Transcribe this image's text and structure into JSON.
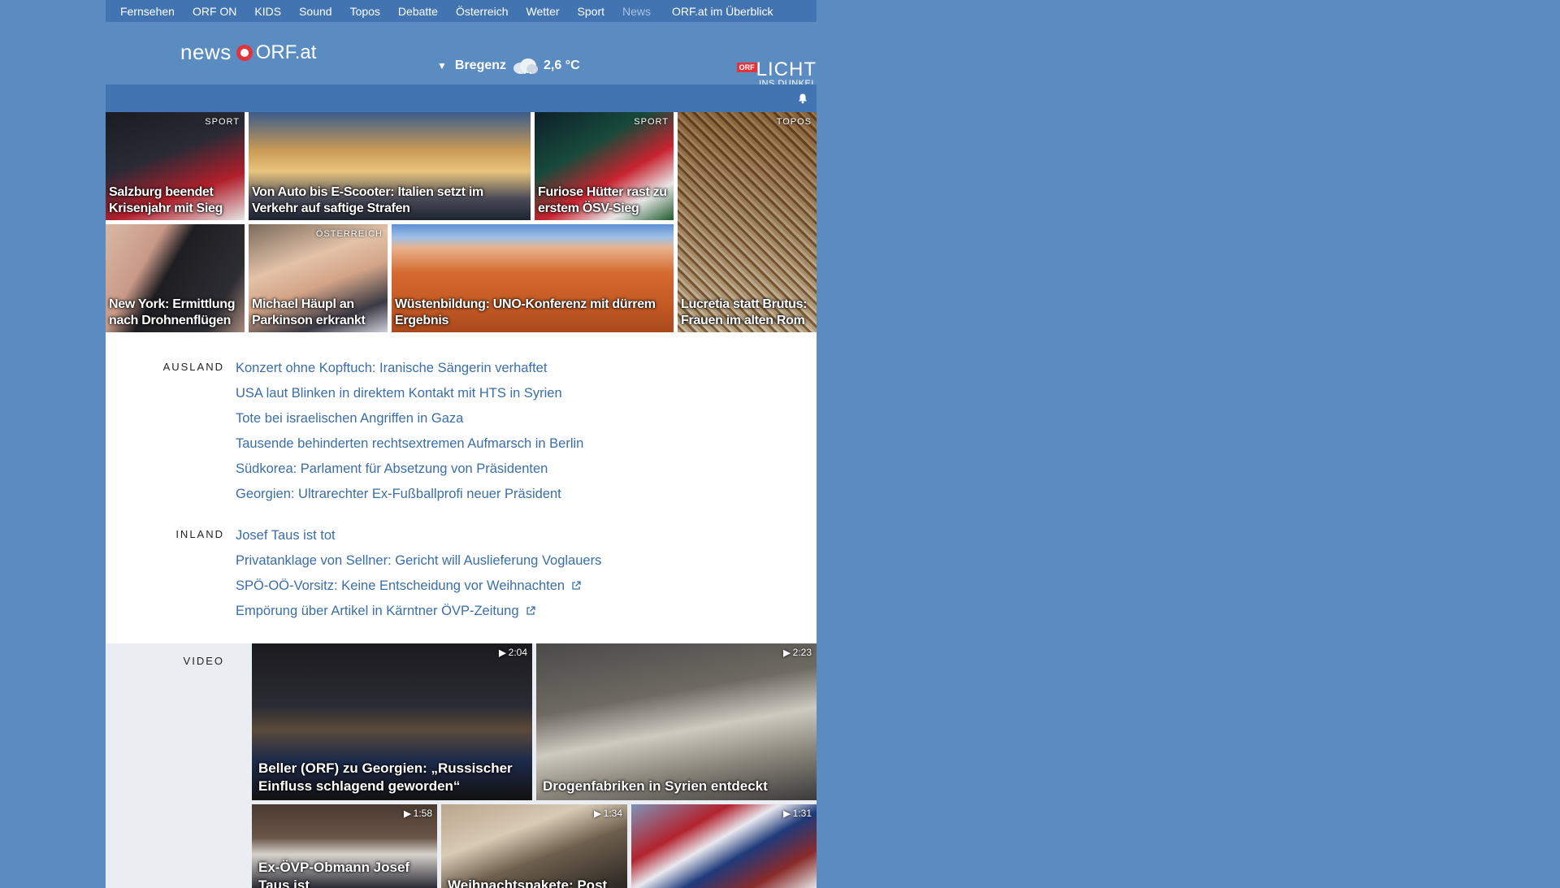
{
  "nav": {
    "items": [
      "Fernsehen",
      "ORF ON",
      "KIDS",
      "Sound",
      "Topos",
      "Debatte",
      "Österreich",
      "Wetter",
      "Sport",
      "News"
    ],
    "overview": "ORF.at im Überblick"
  },
  "header": {
    "logo_news": "news",
    "logo_orf": "ORF.at",
    "weather_city": "Bregenz",
    "weather_temp": "2,6 °C",
    "licht_badge": "ORF",
    "licht_line1": "LICHT",
    "licht_line2": "INS DUNKEL"
  },
  "tiles": [
    {
      "cat": "SPORT",
      "caption": "Salzburg beendet Krisenjahr mit Sieg"
    },
    {
      "cat": "",
      "caption": "Von Auto bis E-Scooter: Italien setzt im Verkehr auf saftige Strafen"
    },
    {
      "cat": "SPORT",
      "caption": "Furiose Hütter rast zu erstem ÖSV-Sieg"
    },
    {
      "cat": "TOPOS",
      "caption": "Lucretia statt Brutus: Frauen im alten Rom"
    },
    {
      "cat": "",
      "caption": "New York: Ermittlung nach Drohnenflügen"
    },
    {
      "cat": "ÖSTERREICH",
      "caption": "Michael Häupl an Parkinson erkrankt"
    },
    {
      "cat": "",
      "caption": "Wüstenbildung: UNO-Konferenz mit dürrem Ergebnis"
    }
  ],
  "sections": [
    {
      "label": "AUSLAND",
      "items": [
        "Konzert ohne Kopftuch: Iranische Sängerin verhaftet",
        "USA laut Blinken in direktem Kontakt mit HTS in Syrien",
        "Tote bei israelischen Angriffen in Gaza",
        "Tausende behinderten rechtsextremen Aufmarsch in Berlin",
        "Südkorea: Parlament für Absetzung von Präsidenten",
        "Georgien: Ultrarechter Ex-Fußballprofi neuer Präsident"
      ]
    },
    {
      "label": "INLAND",
      "items": [
        "Josef Taus ist tot",
        "Privatanklage von Sellner: Gericht will Auslieferung Voglauers",
        "SPÖ-OÖ-Vorsitz: Keine Entscheidung vor Weihnachten",
        "Empörung über Artikel in Kärntner ÖVP-Zeitung"
      ]
    }
  ],
  "video": {
    "label": "VIDEO",
    "items": [
      {
        "dur": "2:04",
        "caption": "Beller (ORF) zu Georgien: „Russischer Einfluss schlagend geworden“"
      },
      {
        "dur": "2:23",
        "caption": "Drogenfabriken in Syrien entdeckt"
      },
      {
        "dur": "1:58",
        "caption": "Ex-ÖVP-Obmann Josef Taus ist"
      },
      {
        "dur": "1:34",
        "caption": "Weihnachtspakete: Post"
      },
      {
        "dur": "1:31",
        "caption": ""
      }
    ]
  },
  "colors": {
    "page_bg": "#5a8cc2",
    "nav_bg": "#4174b0",
    "link": "#3a6ea8",
    "logo_red": "#e3343c"
  }
}
